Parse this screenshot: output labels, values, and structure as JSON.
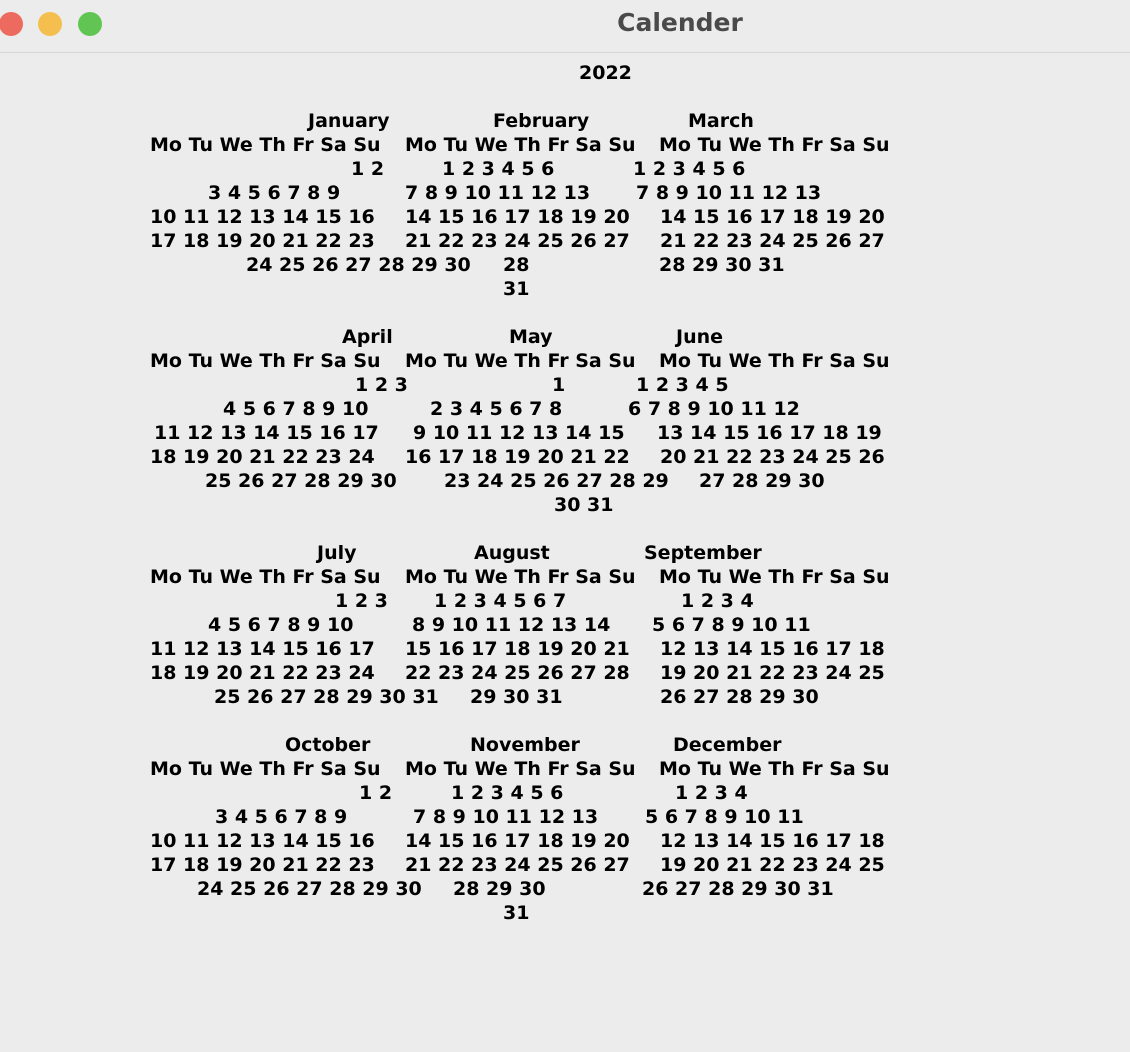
{
  "window": {
    "title": "Calender",
    "close_color": "#ec6a5e",
    "minimize_color": "#f4bf4f",
    "maximize_color": "#61c554"
  },
  "calendar": {
    "year": "2022",
    "weekday_header": "Mo Tu We Th Fr Sa Su",
    "months": [
      {
        "name": "January",
        "lines": [
          "1 2",
          "3 4 5 6 7 8 9",
          "10 11 12 13 14 15 16",
          "17 18 19 20 21 22 23",
          "24 25 26 27 28 29 30",
          "31"
        ]
      },
      {
        "name": "February",
        "lines": [
          "1 2 3 4 5 6",
          "7 8 9 10 11 12 13",
          "14 15 16 17 18 19 20",
          "21 22 23 24 25 26 27",
          "28"
        ]
      },
      {
        "name": "March",
        "lines": [
          "1 2 3 4 5 6",
          "7 8 9 10 11 12 13",
          "14 15 16 17 18 19 20",
          "21 22 23 24 25 26 27",
          "28 29 30 31"
        ]
      },
      {
        "name": "April",
        "lines": [
          "1 2 3",
          "4 5 6 7 8 9 10",
          "11 12 13 14 15 16 17",
          "18 19 20 21 22 23 24",
          "25 26 27 28 29 30"
        ]
      },
      {
        "name": "May",
        "lines": [
          "1",
          "2 3 4 5 6 7 8",
          "9 10 11 12 13 14 15",
          "16 17 18 19 20 21 22",
          "23 24 25 26 27 28 29",
          "30 31"
        ]
      },
      {
        "name": "June",
        "lines": [
          "1 2 3 4 5",
          "6 7 8 9 10 11 12",
          "13 14 15 16 17 18 19",
          "20 21 22 23 24 25 26",
          "27 28 29 30"
        ]
      },
      {
        "name": "July",
        "lines": [
          "1 2 3",
          "4 5 6 7 8 9 10",
          "11 12 13 14 15 16 17",
          "18 19 20 21 22 23 24",
          "25 26 27 28 29 30 31"
        ]
      },
      {
        "name": "August",
        "lines": [
          "1 2 3 4 5 6 7",
          "8 9 10 11 12 13 14",
          "15 16 17 18 19 20 21",
          "22 23 24 25 26 27 28",
          "29 30 31"
        ]
      },
      {
        "name": "September",
        "lines": [
          "1 2 3 4",
          "5 6 7 8 9 10 11",
          "12 13 14 15 16 17 18",
          "19 20 21 22 23 24 25",
          "26 27 28 29 30"
        ]
      },
      {
        "name": "October",
        "lines": [
          "1 2",
          "3 4 5 6 7 8 9",
          "10 11 12 13 14 15 16",
          "17 18 19 20 21 22 23",
          "24 25 26 27 28 29 30",
          "31"
        ]
      },
      {
        "name": "November",
        "lines": [
          "1 2 3 4 5 6",
          "7 8 9 10 11 12 13",
          "14 15 16 17 18 19 20",
          "21 22 23 24 25 26 27",
          "28 29 30"
        ]
      },
      {
        "name": "December",
        "lines": [
          "1 2 3 4",
          "5 6 7 8 9 10 11",
          "12 13 14 15 16 17 18",
          "19 20 21 22 23 24 25",
          "26 27 28 29 30 31"
        ]
      }
    ]
  }
}
